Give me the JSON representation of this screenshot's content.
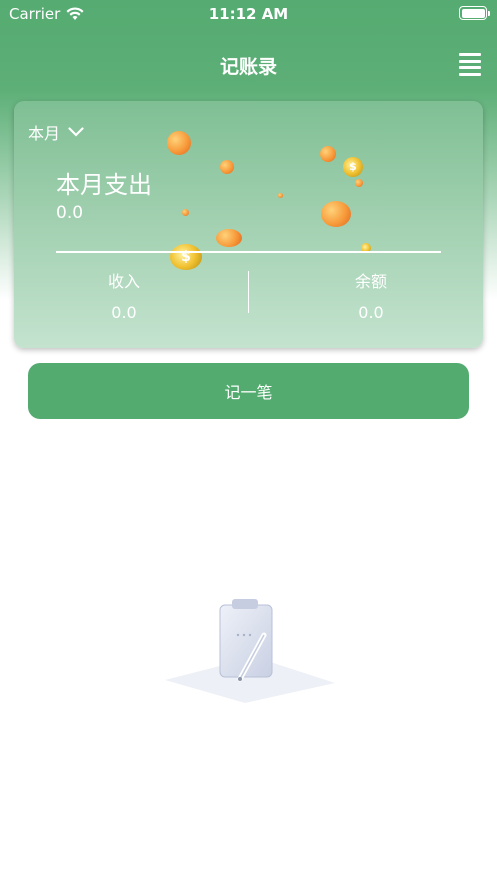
{
  "status_bar": {
    "carrier": "Carrier",
    "time": "11:12 AM",
    "icons": [
      "wifi-icon",
      "battery-icon"
    ]
  },
  "nav": {
    "title": "记账录",
    "menu_icon": "menu-icon"
  },
  "summary": {
    "month_label": "本月",
    "expense_label": "本月支出",
    "expense_value": "0.0",
    "income_label": "收入",
    "income_value": "0.0",
    "balance_label": "余额",
    "balance_value": "0.0"
  },
  "record_button_label": "记一笔",
  "empty_state_icon": "clipboard-pen-icon",
  "colors": {
    "brand_green": "#53ab70",
    "card_top": "#7fbf94",
    "card_bottom": "#c4e3cf"
  }
}
